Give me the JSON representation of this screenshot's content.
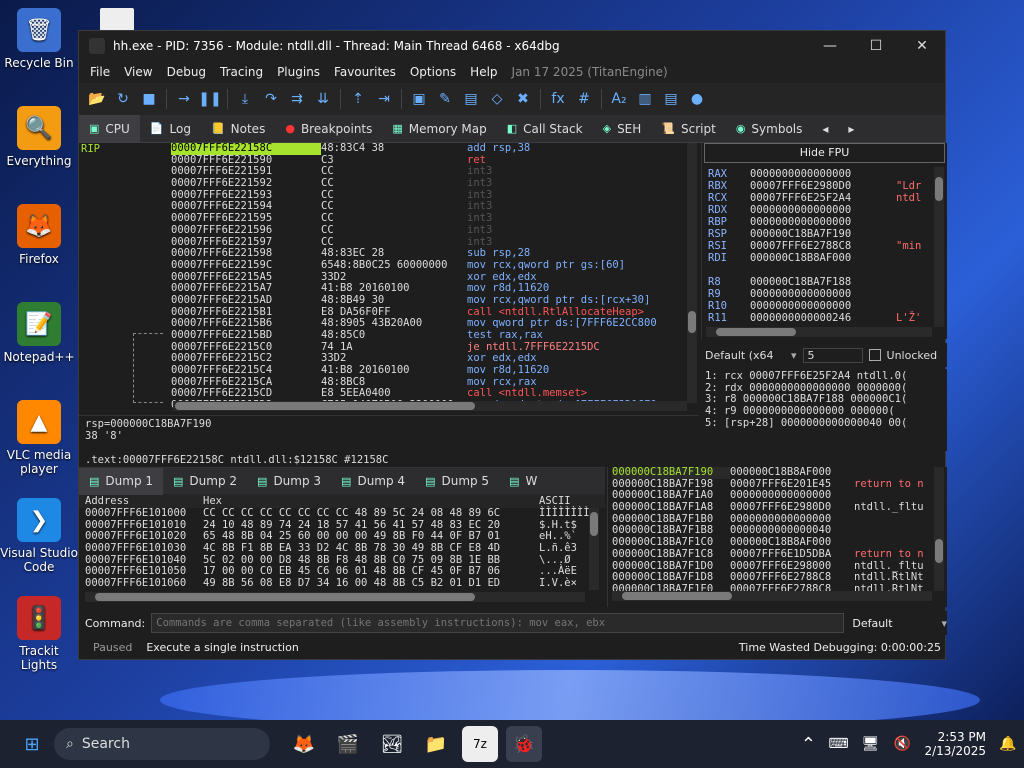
{
  "desktop": {
    "icons": [
      {
        "label": "Recycle Bin",
        "glyph": "🗑"
      },
      {
        "label": "Everything",
        "glyph": "🔍"
      },
      {
        "label": "Firefox",
        "glyph": "🦊"
      },
      {
        "label": "Notepad++",
        "glyph": "📝"
      },
      {
        "label": "VLC media player",
        "glyph": "▲"
      },
      {
        "label": "Visual Studio Code",
        "glyph": "❯"
      },
      {
        "label": "Trackit Lights",
        "glyph": "🚦"
      }
    ]
  },
  "window": {
    "title": "hh.exe - PID: 7356 - Module: ntdll.dll - Thread: Main Thread 6468 - x64dbg",
    "controls": {
      "min": "—",
      "max": "☐",
      "close": "✕"
    }
  },
  "menu": {
    "items": [
      "File",
      "View",
      "Debug",
      "Tracing",
      "Plugins",
      "Favourites",
      "Options",
      "Help"
    ],
    "date": "Jan 17 2025 (TitanEngine)"
  },
  "toolbar": {
    "icons": [
      "📂",
      "↻",
      "■",
      "→",
      "❚❚",
      "⤓",
      "↷",
      "⇉",
      "⇊",
      "⇡",
      "⇥",
      "▣",
      "✎",
      "▤",
      "◇",
      "✖",
      "fx",
      "#",
      "A₂",
      "▥",
      "▤",
      "●"
    ]
  },
  "tabs": [
    "CPU",
    "Log",
    "Notes",
    "Breakpoints",
    "Memory Map",
    "Call Stack",
    "SEH",
    "Script",
    "Symbols"
  ],
  "disasm": {
    "rip_label": "RIP",
    "rows": [
      {
        "addr": "00007FFF6E22158C",
        "bytes": "48:83C4 38",
        "asm": "add rsp,38"
      },
      {
        "addr": "00007FFF6E221590",
        "bytes": "C3",
        "asm": "ret"
      },
      {
        "addr": "00007FFF6E221591",
        "bytes": "CC",
        "asm": "int3"
      },
      {
        "addr": "00007FFF6E221592",
        "bytes": "CC",
        "asm": "int3"
      },
      {
        "addr": "00007FFF6E221593",
        "bytes": "CC",
        "asm": "int3"
      },
      {
        "addr": "00007FFF6E221594",
        "bytes": "CC",
        "asm": "int3"
      },
      {
        "addr": "00007FFF6E221595",
        "bytes": "CC",
        "asm": "int3"
      },
      {
        "addr": "00007FFF6E221596",
        "bytes": "CC",
        "asm": "int3"
      },
      {
        "addr": "00007FFF6E221597",
        "bytes": "CC",
        "asm": "int3"
      },
      {
        "addr": "00007FFF6E221598",
        "bytes": "48:83EC 28",
        "asm": "sub rsp,28"
      },
      {
        "addr": "00007FFF6E22159C",
        "bytes": "6548:8B0C25 60000000",
        "asm": "mov rcx,qword ptr gs:[60]"
      },
      {
        "addr": "00007FFF6E2215A5",
        "bytes": "33D2",
        "asm": "xor edx,edx"
      },
      {
        "addr": "00007FFF6E2215A7",
        "bytes": "41:B8 20160100",
        "asm": "mov r8d,11620"
      },
      {
        "addr": "00007FFF6E2215AD",
        "bytes": "48:8B49 30",
        "asm": "mov rcx,qword ptr ds:[rcx+30]"
      },
      {
        "addr": "00007FFF6E2215B1",
        "bytes": "E8 DA56F0FF",
        "asm": "call <ntdll.RtlAllocateHeap>"
      },
      {
        "addr": "00007FFF6E2215B6",
        "bytes": "48:8905 43B20A00",
        "asm": "mov qword ptr ds:[7FFF6E2CC800"
      },
      {
        "addr": "00007FFF6E2215BD",
        "bytes": "48:85C0",
        "asm": "test rax,rax"
      },
      {
        "addr": "00007FFF6E2215C0",
        "bytes": "74 1A",
        "asm": "je ntdll.7FFF6E2215DC"
      },
      {
        "addr": "00007FFF6E2215C2",
        "bytes": "33D2",
        "asm": "xor edx,edx"
      },
      {
        "addr": "00007FFF6E2215C4",
        "bytes": "41:B8 20160100",
        "asm": "mov r8d,11620"
      },
      {
        "addr": "00007FFF6E2215CA",
        "bytes": "48:8BC8",
        "asm": "mov rcx,rax"
      },
      {
        "addr": "00007FFF6E2215CD",
        "bytes": "E8 5EEA0400",
        "asm": "call <ntdll.memset>"
      },
      {
        "addr": "00007FFF6E2215D2",
        "bytes": "C705 14070B00 3200000",
        "asm": "mov dword ptr ds:[7FFF6E2D1CF0"
      }
    ]
  },
  "info": {
    "line1": "rsp=000000C18BA7F190",
    "line2": "38 '8'",
    "line3": ".text:00007FFF6E22158C ntdll.dll:$12158C #12158C"
  },
  "regs": {
    "hide_fpu": "Hide FPU",
    "rows": [
      {
        "name": "RAX",
        "val": "0000000000000000",
        "cmt": ""
      },
      {
        "name": "RBX",
        "val": "00007FFF6E2980D0",
        "cmt": "\"Ldr"
      },
      {
        "name": "RCX",
        "val": "00007FFF6E25F2A4",
        "cmt": "ntdl"
      },
      {
        "name": "RDX",
        "val": "0000000000000000",
        "cmt": ""
      },
      {
        "name": "RBP",
        "val": "0000000000000000",
        "cmt": ""
      },
      {
        "name": "RSP",
        "val": "000000C18BA7F190",
        "cmt": ""
      },
      {
        "name": "RSI",
        "val": "00007FFF6E2788C8",
        "cmt": "\"min"
      },
      {
        "name": "RDI",
        "val": "000000C18B8AF000",
        "cmt": ""
      },
      {
        "name": "",
        "val": "",
        "cmt": ""
      },
      {
        "name": "R8",
        "val": "000000C18BA7F188",
        "cmt": ""
      },
      {
        "name": "R9",
        "val": "0000000000000000",
        "cmt": ""
      },
      {
        "name": "R10",
        "val": "0000000000000000",
        "cmt": ""
      },
      {
        "name": "R11",
        "val": "0000000000000246",
        "cmt": "L'Ž'"
      }
    ]
  },
  "callconv": {
    "select": "Default (x64",
    "count": "5",
    "unlocked": "Unlocked"
  },
  "args": [
    "1: rcx 00007FFF6E25F2A4 ntdll.0(",
    "2: rdx 0000000000000000 0000000(",
    "3: r8 000000C18BA7F188 000000C1(",
    "4: r9 0000000000000000 000000(",
    "5: [rsp+28] 0000000000000040 00("
  ],
  "dump": {
    "tabs": [
      "Dump 1",
      "Dump 2",
      "Dump 3",
      "Dump 4",
      "Dump 5",
      "W"
    ],
    "col_addr": "Address",
    "col_hex": "Hex",
    "col_ascii": "ASCII",
    "rows": [
      {
        "addr": "00007FFF6E101000",
        "hex": "CC CC CC CC CC CC CC CC 48 89 5C 24 08 48 89 6C",
        "ascii": "ÌÌÌÌÌÌÌÌ"
      },
      {
        "addr": "00007FFF6E101010",
        "hex": "24 10 48 89 74 24 18 57 41 56 41 57 48 83 EC 20",
        "ascii": "$.H.t$"
      },
      {
        "addr": "00007FFF6E101020",
        "hex": "65 48 8B 04 25 60 00 00 00 49 8B F0 44 0F B7 01",
        "ascii": "eH..%`"
      },
      {
        "addr": "00007FFF6E101030",
        "hex": "4C 8B F1 8B EA 33 D2 4C 8B 78 30 49 8B CF E8 4D",
        "ascii": "L.ñ.ê3"
      },
      {
        "addr": "00007FFF6E101040",
        "hex": "5C 02 00 00 D8 48 8B F8 48 8B C0 75 09 8B 1E BB",
        "ascii": "\\...Ø"
      },
      {
        "addr": "00007FFF6E101050",
        "hex": "17 00 00 C0 EB 45 C6 06 01 48 8B CF 45 0F B7 06",
        "ascii": "...ÀëE"
      },
      {
        "addr": "00007FFF6E101060",
        "hex": "49 8B 56 08 E8 D7 34 16 00 48 8B C5 B2 01 D1 ED",
        "ascii": "I.V.è×"
      }
    ]
  },
  "stack": {
    "rows": [
      {
        "addr": "000000C18BA7F190",
        "val": "000000C18B8AF000",
        "cmt": ""
      },
      {
        "addr": "000000C18BA7F198",
        "val": "00007FFF6E201E45",
        "cmt": "return to n"
      },
      {
        "addr": "000000C18BA7F1A0",
        "val": "0000000000000000",
        "cmt": ""
      },
      {
        "addr": "000000C18BA7F1A8",
        "val": "00007FFF6E2980D0",
        "cmt": "ntdll._fltu"
      },
      {
        "addr": "000000C18BA7F1B0",
        "val": "0000000000000000",
        "cmt": ""
      },
      {
        "addr": "000000C18BA7F1B8",
        "val": "0000000000000040",
        "cmt": ""
      },
      {
        "addr": "000000C18BA7F1C0",
        "val": "000000C18B8AF000",
        "cmt": ""
      },
      {
        "addr": "000000C18BA7F1C8",
        "val": "00007FFF6E1D5DBA",
        "cmt": "return to n"
      },
      {
        "addr": "000000C18BA7F1D0",
        "val": "00007FFF6E298000",
        "cmt": "ntdll._fltu"
      },
      {
        "addr": "000000C18BA7F1D8",
        "val": "00007FFF6E2788C8",
        "cmt": "ntdll.RtlNt"
      },
      {
        "addr": "000000C18BA7F1E0",
        "val": "00007FFF6E2788C8",
        "cmt": "ntdll.RtlNt"
      }
    ]
  },
  "command": {
    "label": "Command:",
    "placeholder": "Commands are comma separated (like assembly instructions): mov eax, ebx",
    "mode": "Default"
  },
  "status": {
    "state": "Paused",
    "msg": "Execute a single instruction",
    "time": "Time Wasted Debugging: 0:00:00:25"
  },
  "taskbar": {
    "search": "Search",
    "time": "2:53 PM",
    "date": "2/13/2025"
  },
  "colors": {
    "accent": "#6ab0ff",
    "rip": "#a6e22e",
    "call": "#ff5555",
    "int3": "#555555",
    "regname": "#8ab4ff"
  }
}
